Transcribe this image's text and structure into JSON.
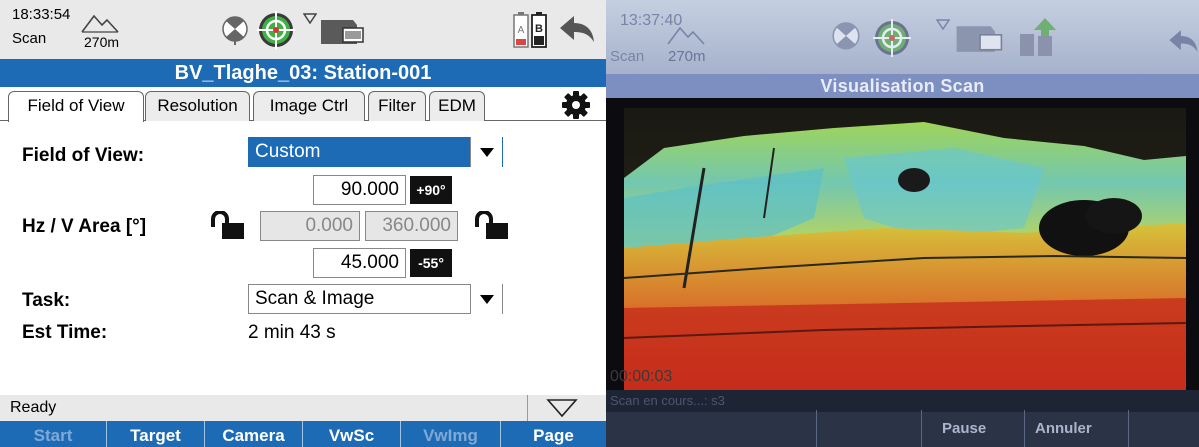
{
  "status": {
    "time": "18:33:54",
    "mode": "Scan",
    "height": "270m",
    "icons": [
      "mountain-icon",
      "satellite-icon",
      "target-icon",
      "wireless-icon",
      "sd-card-icon",
      "battery-a-icon",
      "battery-b-icon",
      "back-arrow-icon"
    ],
    "battery_labels": {
      "a": "A",
      "b": "B"
    }
  },
  "title": "BV_Tlaghe_03: Station-001",
  "tabs": [
    {
      "label": "Field of View",
      "active": true
    },
    {
      "label": "Resolution",
      "active": false
    },
    {
      "label": "Image Ctrl",
      "active": false
    },
    {
      "label": "Filter",
      "active": false
    },
    {
      "label": "EDM",
      "active": false
    }
  ],
  "form": {
    "fov_label": "Field of View:",
    "fov_value": "Custom",
    "area_label": "Hz / V Area [°]",
    "v_top": "90.000",
    "v_top_tag": "+90°",
    "hz_start": "0.000",
    "hz_end": "360.000",
    "v_bottom": "45.000",
    "v_bottom_tag": "-55°",
    "task_label": "Task:",
    "task_value": "Scan & Image",
    "est_label": "Est Time:",
    "est_value": "2 min 43 s"
  },
  "status_line": "Ready",
  "fkeys": [
    {
      "label": "Start",
      "enabled": false
    },
    {
      "label": "Target",
      "enabled": true
    },
    {
      "label": "Camera",
      "enabled": true
    },
    {
      "label": "VwSc",
      "enabled": true
    },
    {
      "label": "VwImg",
      "enabled": false
    },
    {
      "label": "Page",
      "enabled": true
    }
  ],
  "photo": {
    "time": "13:37:40",
    "mode": "Scan",
    "height": "270m",
    "title": "Visualisation Scan",
    "timer": "00:00:03",
    "status": "Scan en cours...: s3",
    "keys": [
      "Pause",
      "Annuler"
    ]
  },
  "colors": {
    "accent": "#1e6bb5",
    "status_bg": "#e9e9e9",
    "tag_bg": "#111111",
    "scan_green": "#7ccf4a",
    "scan_cyan": "#55c6d8",
    "scan_red": "#d43a1f"
  }
}
